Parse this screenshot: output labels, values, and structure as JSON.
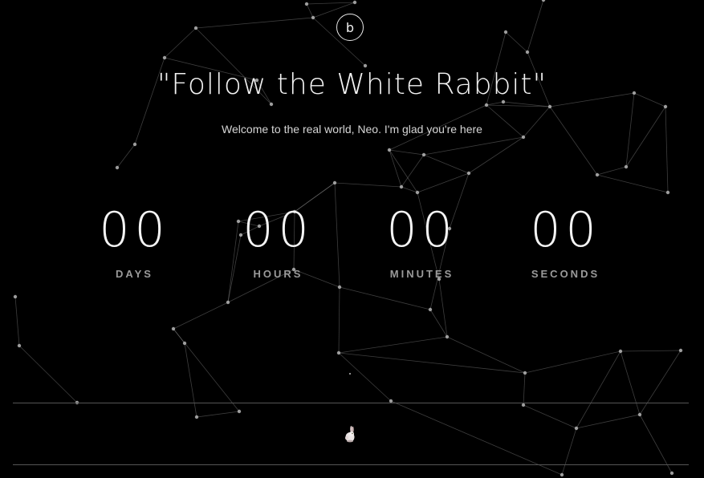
{
  "logo": {
    "letter": "b"
  },
  "headline": "\"Follow the White Rabbit\"",
  "tagline": "Welcome to the real world, Neo. I'm glad you're here",
  "countdown": [
    {
      "value": "00",
      "label": "DAYS"
    },
    {
      "value": "00",
      "label": "HOURS"
    },
    {
      "value": "00",
      "label": "MINUTES"
    },
    {
      "value": "00",
      "label": "SECONDS"
    }
  ],
  "footer": {
    "icon": "rabbit-icon"
  },
  "colors": {
    "background": "#000000",
    "text": "#f2f2f2",
    "label": "#9a9a9a",
    "network": "#8a8a8a",
    "rule": "#555555"
  }
}
